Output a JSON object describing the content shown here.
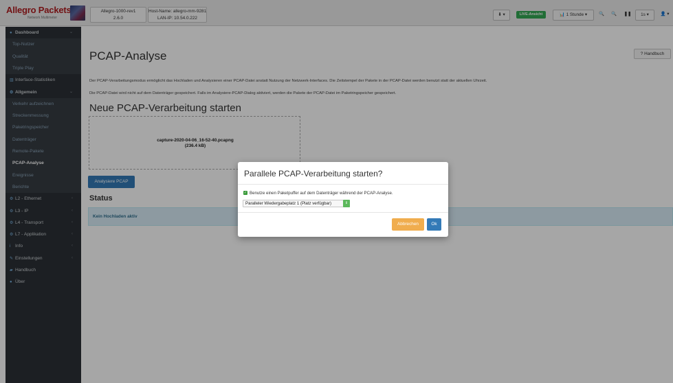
{
  "app": {
    "logo_title": "Allegro Packets",
    "logo_subtitle": "Network Multimeter",
    "device": {
      "model": "Allegro-1000-rev1",
      "version": "2.6.0"
    },
    "host": {
      "name": "Host-Name: allegro-mm-9281",
      "ip": "LAN-IP: 10.54.0.222"
    }
  },
  "toolbar": {
    "download_icon": "⬇ ▾",
    "live_label": "LIVE-Ansicht",
    "time_range_label": "📊 1 Stunde ▾",
    "zoom_in_icon": "🔍",
    "zoom_out_icon": "🔍",
    "pause_icon": "❚❚",
    "interval_label": "1s ▾",
    "user_icon": "👤 ▾"
  },
  "sidebar": {
    "items": [
      {
        "icon": "●",
        "label": "Dashboard",
        "type": "head",
        "chevron": "⌄"
      },
      {
        "label": "Top-Nutzer",
        "type": "sub"
      },
      {
        "label": "Qualität",
        "type": "sub"
      },
      {
        "label": "Triple Play",
        "type": "sub"
      },
      {
        "icon": "▥",
        "label": "Interface-Statistiken",
        "type": "head"
      },
      {
        "icon": "⚙",
        "label": "Allgemein",
        "type": "head",
        "chevron": "⌄"
      },
      {
        "label": "Verkehr aufzeichnen",
        "type": "sub"
      },
      {
        "label": "Streckenmessung",
        "type": "sub"
      },
      {
        "label": "Paketringspeicher",
        "type": "sub"
      },
      {
        "label": "Datenträger",
        "type": "sub"
      },
      {
        "label": "Remote-Pakete",
        "type": "sub"
      },
      {
        "label": "PCAP-Analyse",
        "type": "sub-active"
      },
      {
        "label": "Ereignisse",
        "type": "sub"
      },
      {
        "label": "Berichte",
        "type": "sub"
      },
      {
        "icon": "⚙",
        "label": "L2 - Ethernet",
        "type": "head",
        "chevron": "‹"
      },
      {
        "icon": "⚙",
        "label": "L3 - IP",
        "type": "head",
        "chevron": "‹"
      },
      {
        "icon": "⚙",
        "label": "L4 - Transport",
        "type": "head",
        "chevron": "‹"
      },
      {
        "icon": "⚙",
        "label": "L7 - Applikation",
        "type": "head",
        "chevron": "‹"
      },
      {
        "icon": "i",
        "label": "Info",
        "type": "head",
        "chevron": "‹"
      },
      {
        "icon": "✎",
        "label": "Einstellungen",
        "type": "head",
        "chevron": "‹"
      },
      {
        "icon": "▰",
        "label": "Handbuch",
        "type": "head"
      },
      {
        "icon": "●",
        "label": "Über",
        "type": "head"
      }
    ]
  },
  "main": {
    "title": "PCAP-Analyse",
    "manual_button": "? Handbuch",
    "paragraph1": "Der PCAP-Verarbeitungsmodus ermöglicht das Hochladen und Analysieren einer PCAP-Datei anstatt Nutzung der Netzwerk-Interfaces. Die Zeitstempel der Pakete in der PCAP-Datei werden benutzt statt der aktuellen Uhrzeit.",
    "paragraph2": "Die PCAP-Datei wird nicht auf dem Datenträger gespeichert. Falls im Analysiere-PCAP-Dialog aktiviert, werden die Pakete der PCAP-Datei im Paketringspeicher gespeichert.",
    "subtitle": "Neue PCAP-Verarbeitung starten",
    "file_name": "capture-2020-04-06_16-52-40.pcapng",
    "file_size": "(236.4 kB)",
    "analyze_button": "Analysiere PCAP",
    "status_title": "Status",
    "status_text": "Kein Hochladen aktiv"
  },
  "modal": {
    "title": "Parallele PCAP-Verarbeitung starten?",
    "checkbox_label": "Benutze einen Paketpuffer auf dem Datenträger während der PCAP-Analyse.",
    "checkbox_checked": true,
    "select_value": "Paralleler Wiedergabeplatz 1 (Platz verfügbar)",
    "cancel_button": "Abbrechen",
    "ok_button": "Ok"
  }
}
